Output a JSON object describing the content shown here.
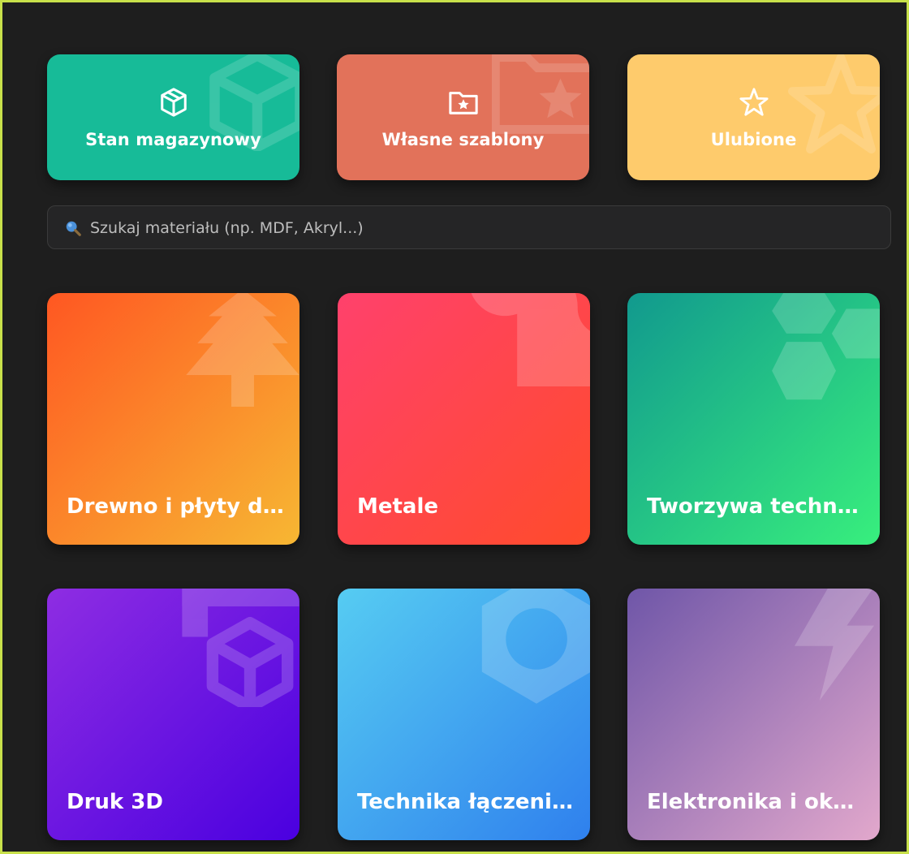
{
  "quick_actions": [
    {
      "label": "Stan magazynowy",
      "icon": "box-icon",
      "color": "#1abc9c"
    },
    {
      "label": "Własne szablony",
      "icon": "folder-star-icon",
      "color": "#e07057"
    },
    {
      "label": "Ulubione",
      "icon": "star-icon",
      "color": "#fcc96a"
    }
  ],
  "search": {
    "placeholder": "Szukaj materiału (np. MDF, Akryl...)",
    "icon": "magnifier-icon"
  },
  "categories": [
    {
      "label": "Drewno i płyty drewnopochodne",
      "icon": "tree-icon",
      "colors": [
        "#ff5722",
        "#f7b733"
      ]
    },
    {
      "label": "Metale",
      "icon": "wrench-icon",
      "colors": [
        "#ff416c",
        "#ff4b2b"
      ]
    },
    {
      "label": "Tworzywa techniczne",
      "icon": "hexagons-icon",
      "colors": [
        "#11998e",
        "#38ef7d"
      ]
    },
    {
      "label": "Druk 3D",
      "icon": "cube-icon",
      "colors": [
        "#8e2de2",
        "#4a00e0"
      ]
    },
    {
      "label": "Technika łączenia elementów",
      "icon": "nut-icon",
      "colors": [
        "#56ccf2",
        "#2f80ed"
      ]
    },
    {
      "label": "Elektronika i okablowanie",
      "icon": "lightning-icon",
      "colors": [
        "#6f56a8",
        "#e2a8cc"
      ]
    }
  ]
}
